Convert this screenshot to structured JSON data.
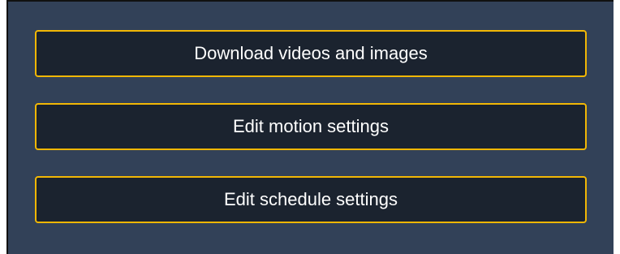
{
  "colors": {
    "panel_background": "#324158",
    "button_background": "#1b232f",
    "button_border": "#f2b705",
    "button_text": "#ffffff"
  },
  "menu": {
    "buttons": [
      {
        "label": "Download videos and images"
      },
      {
        "label": "Edit motion settings"
      },
      {
        "label": "Edit schedule settings"
      }
    ]
  }
}
